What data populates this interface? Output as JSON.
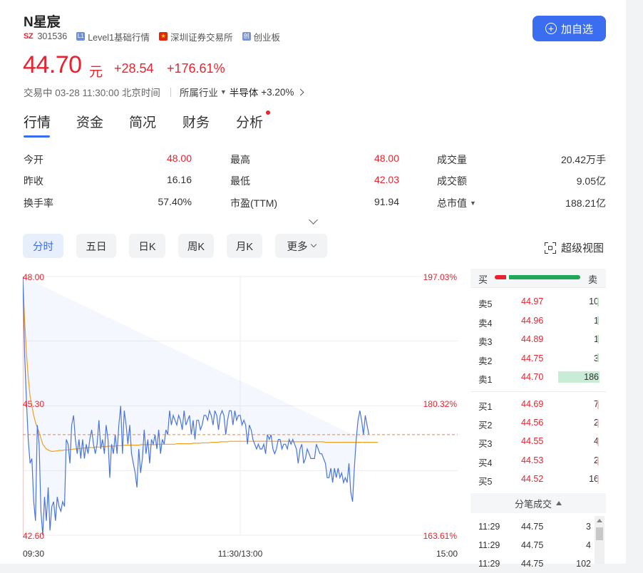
{
  "stock": {
    "name": "N星宸",
    "exchange_code": "SZ",
    "code": "301536",
    "level_badge": "L1",
    "level_label": "Level1基础行情",
    "exchange_name": "深圳证券交易所",
    "board_badge": "创",
    "board_label": "创业板",
    "add_button": "加自选",
    "price": "44.70",
    "unit": "元",
    "change": "+28.54",
    "change_pct": "+176.61%",
    "status": "交易中 03-28 11:30:00 北京时间",
    "industry_label": "所属行业",
    "industry_name": "半导体",
    "industry_pct": "+3.20%"
  },
  "tabs": [
    "行情",
    "资金",
    "简况",
    "财务",
    "分析"
  ],
  "quote": {
    "col1": [
      [
        "今开",
        "48.00"
      ],
      [
        "昨收",
        "16.16"
      ],
      [
        "换手率",
        "57.40%"
      ]
    ],
    "col2": [
      [
        "最高",
        "48.00"
      ],
      [
        "最低",
        "42.03"
      ],
      [
        "市盈(TTM)",
        "91.94"
      ]
    ],
    "col3": [
      [
        "成交量",
        "20.42万手"
      ],
      [
        "成交额",
        "9.05亿"
      ],
      [
        "总市值",
        "188.21亿"
      ]
    ]
  },
  "periods": [
    "分时",
    "五日",
    "日K",
    "周K",
    "月K",
    "更多"
  ],
  "super_view": "超级视图",
  "colors": {
    "up": "#e8232f",
    "down": "#1fa855",
    "accent": "#3a6df0",
    "price_line": "#4a74e0",
    "avg_line": "#f0a020"
  },
  "chart_data": {
    "type": "line",
    "title": "",
    "y_left_ticks": [
      "48.00",
      "45.30",
      "42.60"
    ],
    "y_right_ticks": [
      "197.03%",
      "180.32%",
      "163.61%"
    ],
    "x_ticks": [
      "09:30",
      "11:30/13:00",
      "15:00"
    ],
    "ylim": [
      42.6,
      48.0
    ],
    "xlim": [
      0,
      240
    ],
    "last_price": 44.7,
    "series": [
      {
        "values": [
          48.0,
          46.4,
          45.4,
          44.6,
          44.1,
          44.2,
          43.3,
          42.9,
          44.9,
          44.5,
          43.1,
          42.6,
          43.4,
          42.9,
          43.6,
          42.7,
          43.2,
          43.3,
          42.9,
          43.4,
          43.2,
          43.1,
          43.3,
          43.2,
          44.6,
          44.5,
          44.1,
          44.9,
          45.1,
          44.6,
          44.3,
          44.6,
          44.2,
          44.6,
          44.2,
          44.5,
          44.3,
          44.6,
          44.8,
          44.5,
          44.3,
          44.5,
          45.0,
          44.4,
          44.6,
          44.3,
          44.9,
          44.6,
          43.8,
          44.5,
          44.3,
          44.7,
          44.3,
          44.9,
          45.3,
          44.3,
          45.2,
          44.9,
          44.5,
          44.9,
          44.3,
          44.1,
          43.9,
          43.6,
          44.4,
          43.9,
          44.2,
          44.8,
          44.3,
          44.6,
          44.1,
          44.6,
          44.5,
          44.7,
          44.4,
          44.8,
          44.3,
          44.6,
          44.5,
          44.8,
          44.7,
          45.2,
          44.9,
          45.1,
          45.0,
          44.9,
          45.1,
          45.0,
          44.8,
          45.2,
          44.9,
          45.0,
          45.1,
          44.7,
          45.0,
          44.6,
          45.0,
          45.0,
          44.8,
          44.9,
          45.1,
          45.1,
          45.0,
          45.2,
          45.1,
          44.9,
          45.2,
          45.1,
          44.8,
          45.1,
          45.2,
          45.1,
          44.7,
          45.0,
          45.2,
          45.2,
          44.9,
          45.2,
          45.0,
          45.1,
          45.1,
          44.9,
          45.0,
          44.9,
          44.5,
          44.9,
          44.8,
          44.6,
          44.5,
          44.4,
          44.5,
          44.4,
          44.4,
          44.5,
          44.3,
          44.7,
          44.6,
          44.7,
          44.4,
          44.3,
          44.4,
          44.6,
          44.6,
          44.4,
          44.5,
          44.5,
          44.4,
          44.6,
          44.5,
          44.6,
          44.5,
          44.4,
          44.1,
          44.4,
          44.5,
          44.1,
          44.2,
          44.4,
          44.3,
          44.2,
          44.2,
          44.2,
          44.5,
          44.4,
          44.3,
          44.3,
          44.2,
          44.1,
          43.8,
          43.8,
          44.0,
          43.7,
          44.0,
          43.8,
          44.0,
          43.8,
          43.9,
          43.7,
          43.8,
          43.7,
          44.1,
          43.5,
          43.3,
          44.0,
          44.6,
          45.0,
          45.2,
          45.0,
          44.7,
          45.1,
          44.9,
          44.7
        ]
      },
      {
        "values": [
          48.0,
          47.1,
          46.4,
          45.9,
          45.5,
          45.3,
          45.1,
          44.95,
          44.85,
          44.75,
          44.62,
          44.5,
          44.45,
          44.4,
          44.38,
          44.36,
          44.35,
          44.35,
          44.36,
          44.36,
          44.37,
          44.37,
          44.37,
          44.38,
          44.38,
          44.38,
          44.39,
          44.39,
          44.4,
          44.4,
          44.4,
          44.41,
          44.41,
          44.42,
          44.42,
          44.42,
          44.43,
          44.43,
          44.43,
          44.43,
          44.44,
          44.44,
          44.44,
          44.44,
          44.45,
          44.45,
          44.45,
          44.46,
          44.46,
          44.46,
          44.46,
          44.46,
          44.47,
          44.47,
          44.47,
          44.47,
          44.48,
          44.48,
          44.48,
          44.48,
          44.48,
          44.48,
          44.48,
          44.48,
          44.48,
          44.49,
          44.49,
          44.49,
          44.49,
          44.49,
          44.49,
          44.49,
          44.49,
          44.49,
          44.5,
          44.5,
          44.5,
          44.5,
          44.5,
          44.5,
          44.5,
          44.5,
          44.5,
          44.5,
          44.5,
          44.51,
          44.51,
          44.51,
          44.51,
          44.51,
          44.51,
          44.51,
          44.51,
          44.51,
          44.52,
          44.52,
          44.52,
          44.52,
          44.52,
          44.53,
          44.53,
          44.53,
          44.53,
          44.53,
          44.54,
          44.54,
          44.54,
          44.54,
          44.54,
          44.55,
          44.55,
          44.55,
          44.55,
          44.55,
          44.56,
          44.56,
          44.56,
          44.56,
          44.56,
          44.56,
          44.56,
          44.56,
          44.56,
          44.56,
          44.56,
          44.56,
          44.56,
          44.56,
          44.56,
          44.56,
          44.56,
          44.56,
          44.56,
          44.56,
          44.56,
          44.56,
          44.56,
          44.56,
          44.56,
          44.56,
          44.56,
          44.56,
          44.56,
          44.56,
          44.56,
          44.56,
          44.56,
          44.56,
          44.56,
          44.55,
          44.55,
          44.55,
          44.55,
          44.55,
          44.55,
          44.55,
          44.55,
          44.55,
          44.55,
          44.55,
          44.55,
          44.55,
          44.55,
          44.55,
          44.55,
          44.55,
          44.55,
          44.54,
          44.54,
          44.54,
          44.54,
          44.54,
          44.54,
          44.54,
          44.54,
          44.54,
          44.54,
          44.54,
          44.54,
          44.54,
          44.54,
          44.54,
          44.54,
          44.54,
          44.54,
          44.54,
          44.54,
          44.54,
          44.54,
          44.54,
          44.54,
          44.54,
          44.54,
          44.54,
          44.54,
          44.54,
          44.54
        ]
      }
    ]
  },
  "orderbook": {
    "head_buy": "买",
    "head_sell": "卖",
    "buy_ratio": 0.13,
    "sells": [
      {
        "label": "卖5",
        "price": "44.97",
        "vol": "10"
      },
      {
        "label": "卖4",
        "price": "44.96",
        "vol": "1"
      },
      {
        "label": "卖3",
        "price": "44.89",
        "vol": "1"
      },
      {
        "label": "卖2",
        "price": "44.75",
        "vol": "3"
      },
      {
        "label": "卖1",
        "price": "44.70",
        "vol": "186"
      }
    ],
    "buys": [
      {
        "label": "买1",
        "price": "44.69",
        "vol": "7"
      },
      {
        "label": "买2",
        "price": "44.56",
        "vol": "2"
      },
      {
        "label": "买3",
        "price": "44.55",
        "vol": "4"
      },
      {
        "label": "买4",
        "price": "44.53",
        "vol": "2"
      },
      {
        "label": "买5",
        "price": "44.52",
        "vol": "16"
      }
    ],
    "ticks_title": "分笔成交",
    "ticks": [
      {
        "time": "11:29",
        "price": "44.75",
        "vol": "3"
      },
      {
        "time": "11:29",
        "price": "44.75",
        "vol": "4"
      },
      {
        "time": "11:29",
        "price": "44.75",
        "vol": "102"
      }
    ]
  }
}
